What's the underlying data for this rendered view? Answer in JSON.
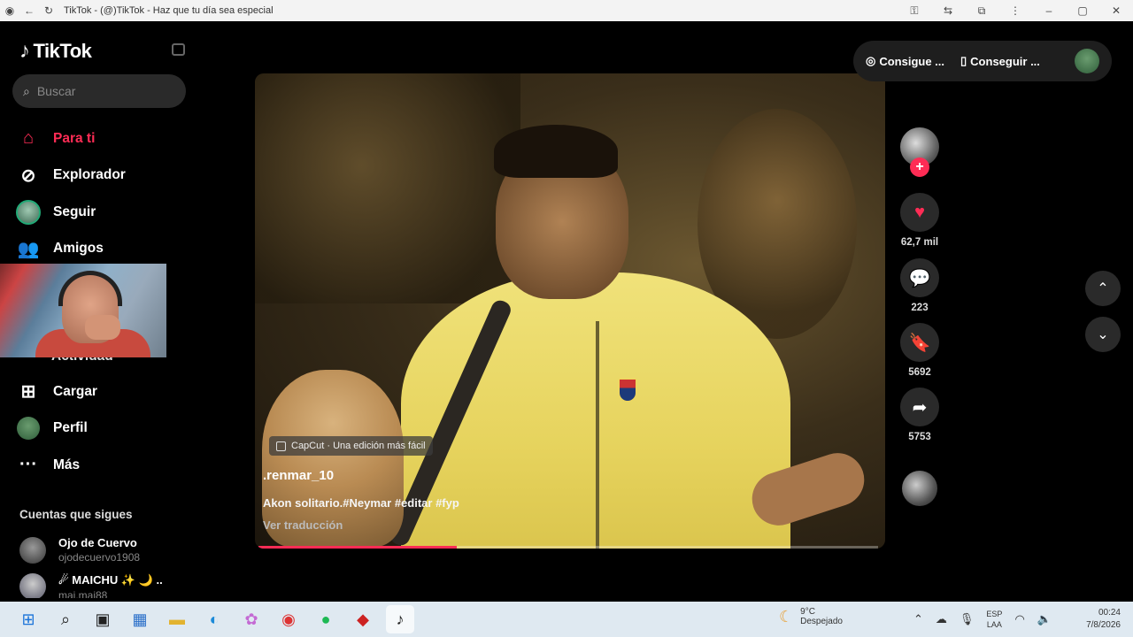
{
  "browser": {
    "title": "TikTok - (@)TikTok - Haz que tu día sea especial"
  },
  "sidebar": {
    "logo": "TikTok",
    "search_placeholder": "Buscar",
    "nav": [
      {
        "label": "Para ti",
        "icon": "home-icon",
        "active": true
      },
      {
        "label": "Explorador",
        "icon": "compass-icon"
      },
      {
        "label": "Seguir",
        "icon": "avatar-icon"
      },
      {
        "label": "Amigos",
        "icon": "friends-icon"
      }
    ],
    "activity_partial": "Actividad",
    "nav2": [
      {
        "label": "Cargar",
        "icon": "upload-icon"
      },
      {
        "label": "Perfil",
        "icon": "profile-avatar"
      },
      {
        "label": "Más",
        "icon": "more-icon"
      }
    ],
    "following_title": "Cuentas que sigues",
    "accounts": [
      {
        "name": "Ojo de Cuervo",
        "handle": "ojodecuervo1908"
      },
      {
        "name": "☄ MAICHU ✨ 🌙 ..",
        "handle": "mai.mai88"
      }
    ]
  },
  "video": {
    "badge": "CapCut · Una edición más fácil",
    "username": ".renmar_10",
    "caption": "Akon solitario.#Neymar #editar #fyp",
    "translate": "Ver traducción",
    "progress": 0.32
  },
  "actions": {
    "likes": "62,7 mil",
    "comments": "223",
    "saves": "5692",
    "shares": "5753"
  },
  "topbar": {
    "get_coins": "Consigue ...",
    "get_app": "Conseguir ..."
  },
  "taskbar": {
    "weather_temp": "9°C",
    "weather_desc": "Despejado",
    "lang_1": "ESP",
    "lang_2": "LAA",
    "time": "00:24",
    "date": "7/8/2026"
  }
}
